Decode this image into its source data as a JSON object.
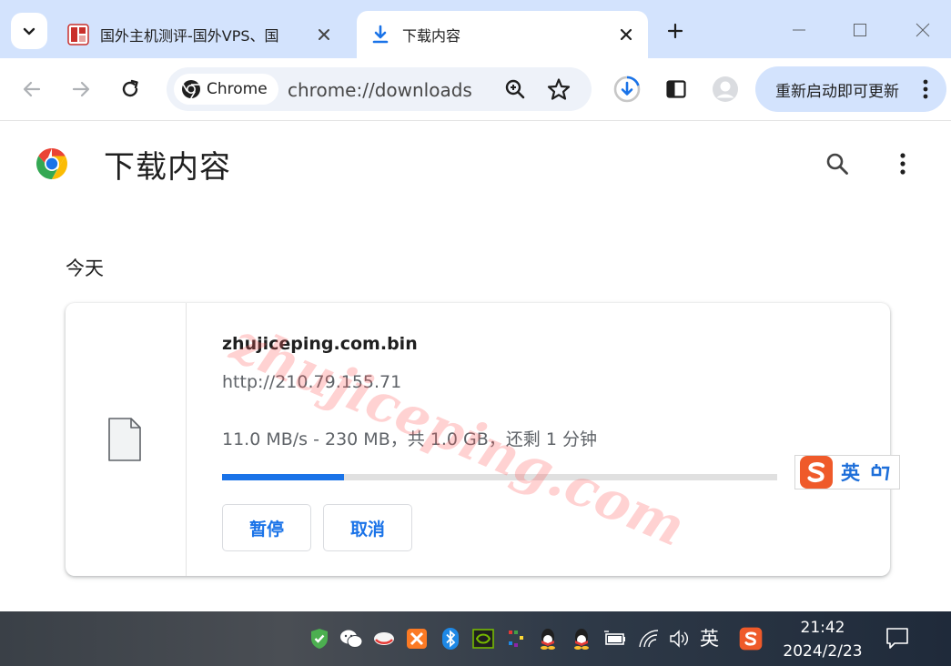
{
  "browser": {
    "tabs": [
      {
        "title": "国外主机测评-国外VPS、国",
        "active": false,
        "favicon": "site-favicon"
      },
      {
        "title": "下载内容",
        "active": true,
        "favicon": "download-icon"
      }
    ],
    "omnibox": {
      "chip_label": "Chrome",
      "url": "chrome://downloads"
    },
    "update_button_label": "重新启动即可更新"
  },
  "page": {
    "title": "下载内容",
    "section_label": "今天"
  },
  "download": {
    "file_name": "zhujiceping.com.bin",
    "source_url": "http://210.79.155.71",
    "status": "11.0 MB/s - 230 MB，共 1.0 GB，还剩 1 分钟",
    "progress_fraction": 0.22,
    "pause_label": "暂停",
    "cancel_label": "取消"
  },
  "watermark": "zhujiceping.com",
  "ime": {
    "mode": "英"
  },
  "taskbar": {
    "input_indicator": "英",
    "time": "21:42",
    "date": "2024/2/23"
  },
  "colors": {
    "accent": "#1a73e8",
    "tabstrip": "#d3e3fd",
    "omnibox": "#eef2f9"
  }
}
